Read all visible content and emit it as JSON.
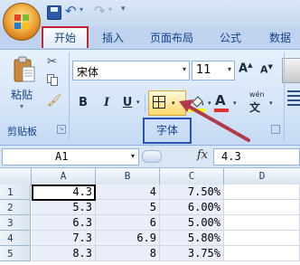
{
  "quick_access": {
    "save_icon": "save-icon",
    "undo_icon": "undo-icon",
    "redo_icon": "redo-icon",
    "dropdown_glyph": "▾",
    "undo_glyph": "↶",
    "redo_glyph": "↷",
    "customize_glyph": "▾"
  },
  "tabs": {
    "home": "开始",
    "insert": "插入",
    "page_layout": "页面布局",
    "formulas": "公式",
    "data": "数据"
  },
  "clipboard": {
    "paste_label": "粘贴",
    "group_label": "剪贴板",
    "cut_glyph": "✂",
    "painter_glyph": "🖌"
  },
  "font": {
    "name": "宋体",
    "size": "11",
    "grow": "A",
    "shrink": "A",
    "bold": "B",
    "italic": "I",
    "underline": "U",
    "font_color_glyph": "A",
    "phonetic_top": "wén",
    "phonetic_bottom": "文",
    "group_label": "字体",
    "dropdown_glyph": "▾",
    "fill_color": "#ffff00",
    "font_color": "#e03030"
  },
  "formula_bar": {
    "name_box": "A1",
    "fx": "fx",
    "value": "4.3"
  },
  "sheet": {
    "columns": [
      "A",
      "B",
      "C",
      "D"
    ],
    "rows": [
      {
        "num": "1",
        "a": "4.3",
        "b": "4",
        "c": "7.50%"
      },
      {
        "num": "2",
        "a": "5.3",
        "b": "5",
        "c": "6.00%"
      },
      {
        "num": "3",
        "a": "6.3",
        "b": "6",
        "c": "5.00%"
      },
      {
        "num": "4",
        "a": "7.3",
        "b": "6.9",
        "c": "5.80%"
      },
      {
        "num": "5",
        "a": "8.3",
        "b": "8",
        "c": "3.75%"
      }
    ]
  },
  "colors": {
    "home_tab_highlight": "#c0262d",
    "font_group_highlight": "#2c52b8",
    "arrow": "#b03a4a",
    "ribbon_text": "#15428b"
  }
}
